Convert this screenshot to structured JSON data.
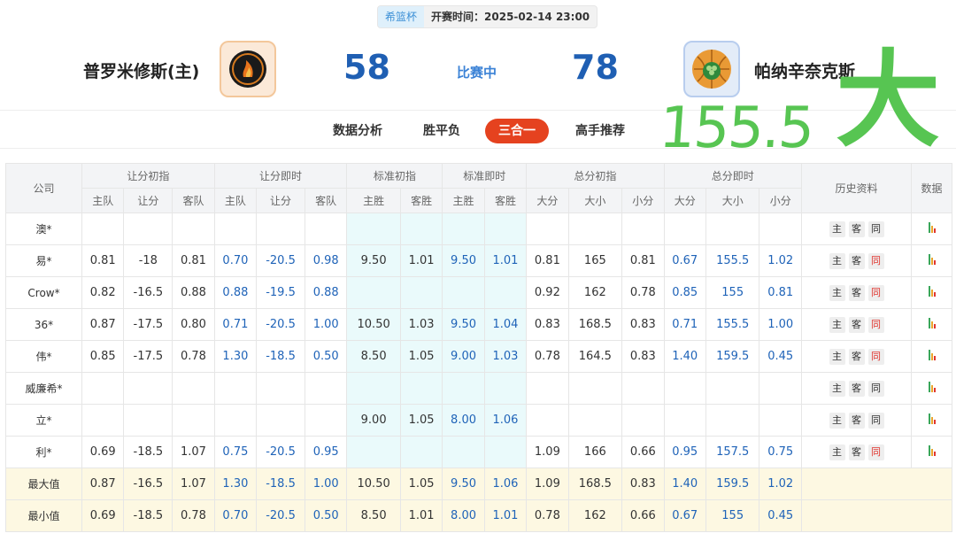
{
  "header": {
    "league": "希篮杯",
    "start_time": "开赛时间：2025-02-14 23:00",
    "home_name": "普罗米修斯(主)",
    "away_name": "帕纳辛奈克斯",
    "home_score": "58",
    "away_score": "78",
    "status": "比赛中"
  },
  "tabs": [
    "数据分析",
    "胜平负",
    "三合一",
    "高手推荐"
  ],
  "active_tab": "三合一",
  "handwriting": {
    "number": "155.5",
    "word": "大"
  },
  "table": {
    "group_headers": [
      "公司",
      "让分初指",
      "让分即时",
      "标准初指",
      "标准即时",
      "总分初指",
      "总分即时",
      "历史资料",
      "数据"
    ],
    "sub_headers": [
      "主队",
      "让分",
      "客队",
      "主队",
      "让分",
      "客队",
      "主胜",
      "客胜",
      "主胜",
      "客胜",
      "大分",
      "大小",
      "小分",
      "大分",
      "大小",
      "小分"
    ],
    "history_labels": [
      "主",
      "客",
      "同"
    ],
    "rows": [
      {
        "company": "澳*",
        "v": [
          "",
          "",
          "",
          "",
          "",
          "",
          "",
          "",
          "",
          "",
          "",
          "",
          "",
          "",
          "",
          ""
        ],
        "tong_red": false
      },
      {
        "company": "易*",
        "v": [
          "0.81",
          "-18",
          "0.81",
          "0.70",
          "-20.5",
          "0.98",
          "9.50",
          "1.01",
          "9.50",
          "1.01",
          "0.81",
          "165",
          "0.81",
          "0.67",
          "155.5",
          "1.02"
        ],
        "tong_red": true
      },
      {
        "company": "Crow*",
        "v": [
          "0.82",
          "-16.5",
          "0.88",
          "0.88",
          "-19.5",
          "0.88",
          "",
          "",
          "",
          "",
          "0.92",
          "162",
          "0.78",
          "0.85",
          "155",
          "0.81"
        ],
        "tong_red": true
      },
      {
        "company": "36*",
        "v": [
          "0.87",
          "-17.5",
          "0.80",
          "0.71",
          "-20.5",
          "1.00",
          "10.50",
          "1.03",
          "9.50",
          "1.04",
          "0.83",
          "168.5",
          "0.83",
          "0.71",
          "155.5",
          "1.00"
        ],
        "tong_red": true
      },
      {
        "company": "伟*",
        "v": [
          "0.85",
          "-17.5",
          "0.78",
          "1.30",
          "-18.5",
          "0.50",
          "8.50",
          "1.05",
          "9.00",
          "1.03",
          "0.78",
          "164.5",
          "0.83",
          "1.40",
          "159.5",
          "0.45"
        ],
        "tong_red": true
      },
      {
        "company": "威廉希*",
        "v": [
          "",
          "",
          "",
          "",
          "",
          "",
          "",
          "",
          "",
          "",
          "",
          "",
          "",
          "",
          "",
          ""
        ],
        "tong_red": false
      },
      {
        "company": "立*",
        "v": [
          "",
          "",
          "",
          "",
          "",
          "",
          "9.00",
          "1.05",
          "8.00",
          "1.06",
          "",
          "",
          "",
          "",
          "",
          ""
        ],
        "tong_red": false
      },
      {
        "company": "利*",
        "v": [
          "0.69",
          "-18.5",
          "1.07",
          "0.75",
          "-20.5",
          "0.95",
          "",
          "",
          "",
          "",
          "1.09",
          "166",
          "0.66",
          "0.95",
          "157.5",
          "0.75"
        ],
        "tong_red": true
      }
    ],
    "summary": [
      {
        "label": "最大值",
        "v": [
          "0.87",
          "-16.5",
          "1.07",
          "1.30",
          "-18.5",
          "1.00",
          "10.50",
          "1.05",
          "9.50",
          "1.06",
          "1.09",
          "168.5",
          "0.83",
          "1.40",
          "159.5",
          "1.02"
        ]
      },
      {
        "label": "最小值",
        "v": [
          "0.69",
          "-18.5",
          "0.78",
          "0.70",
          "-20.5",
          "0.50",
          "8.50",
          "1.01",
          "8.00",
          "1.01",
          "0.78",
          "162",
          "0.66",
          "0.67",
          "155",
          "0.45"
        ]
      }
    ]
  },
  "colors": {
    "accent_red": "#e5421f",
    "score_blue": "#1f5fb3",
    "handwriting_green": "#57c552",
    "std_bg": "#eafafb",
    "summary_bg": "#fdf8e2"
  }
}
